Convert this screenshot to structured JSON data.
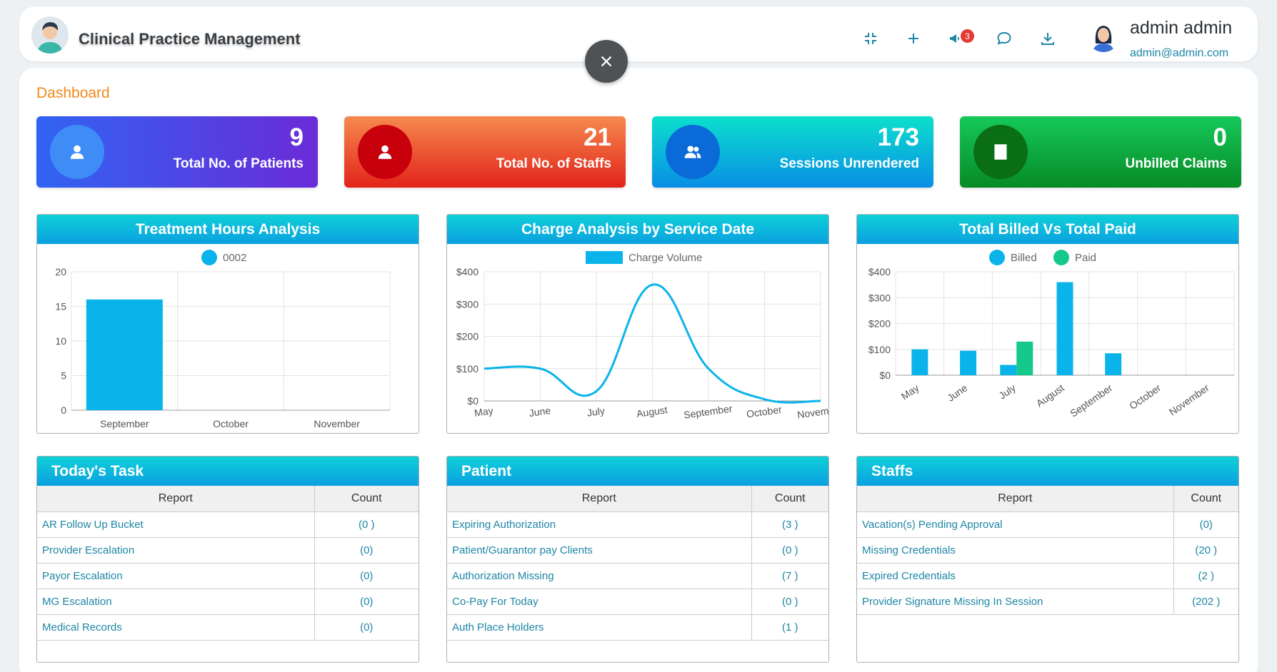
{
  "header": {
    "app_title": "Clinical Practice Management",
    "notification_count": "3",
    "user_name": "admin admin",
    "user_email": "admin@admin.com",
    "icons": [
      "compress-icon",
      "plus-icon",
      "megaphone-icon",
      "chat-icon",
      "download-icon"
    ]
  },
  "page": {
    "title": "Dashboard"
  },
  "stats": [
    {
      "value": "9",
      "label": "Total No. of Patients",
      "color": "#3d5af1",
      "icon": "user-icon"
    },
    {
      "value": "21",
      "label": "Total No. of Staffs",
      "color": "#e53935",
      "icon": "user-icon"
    },
    {
      "value": "173",
      "label": "Sessions Unrendered",
      "color": "#0ab3d9",
      "icon": "users-icon"
    },
    {
      "value": "0",
      "label": "Unbilled Claims",
      "color": "#1faa34",
      "icon": "building-icon"
    }
  ],
  "charts": {
    "treatment": {
      "title": "Treatment Hours Analysis"
    },
    "charge": {
      "title": "Charge Analysis by Service Date"
    },
    "billed": {
      "title": "Total Billed Vs Total Paid"
    }
  },
  "chart_data": [
    {
      "type": "bar",
      "title": "Treatment Hours Analysis",
      "categories": [
        "September",
        "October",
        "November"
      ],
      "series": [
        {
          "name": "0002",
          "values": [
            16,
            0,
            0
          ]
        }
      ],
      "ylim": [
        0,
        20
      ],
      "yticks": [
        0,
        5,
        10,
        15,
        20
      ],
      "grid": true,
      "legend": "top",
      "colors": [
        "#0ab4ea"
      ]
    },
    {
      "type": "line",
      "title": "Charge Analysis by Service Date",
      "categories": [
        "May",
        "June",
        "July",
        "August",
        "September",
        "October",
        "November"
      ],
      "series": [
        {
          "name": "Charge Volume",
          "values": [
            100,
            100,
            30,
            360,
            100,
            5,
            0
          ]
        }
      ],
      "ylim": [
        0,
        400
      ],
      "yticks": [
        "$0",
        "$100",
        "$200",
        "$300",
        "$400"
      ],
      "grid": true,
      "legend": "top",
      "colors": [
        "#0ab4ea"
      ]
    },
    {
      "type": "bar",
      "title": "Total Billed Vs Total Paid",
      "categories": [
        "May",
        "June",
        "July",
        "August",
        "September",
        "October",
        "November"
      ],
      "series": [
        {
          "name": "Billed",
          "values": [
            100,
            95,
            40,
            360,
            85,
            0,
            0
          ]
        },
        {
          "name": "Paid",
          "values": [
            0,
            0,
            130,
            0,
            0,
            0,
            0
          ]
        }
      ],
      "ylim": [
        0,
        400
      ],
      "yticks": [
        "$0",
        "$100",
        "$200",
        "$300",
        "$400"
      ],
      "grid": true,
      "legend": "top",
      "colors": [
        "#0ab4ea",
        "#14c98a"
      ]
    }
  ],
  "tables": [
    {
      "title": "Today's Task",
      "col_report": "Report",
      "col_count": "Count",
      "rows": [
        {
          "report": "AR Follow Up Bucket",
          "count": "(0 )"
        },
        {
          "report": "Provider Escalation",
          "count": "(0)"
        },
        {
          "report": "Payor Escalation",
          "count": "(0)"
        },
        {
          "report": "MG Escalation",
          "count": "(0)"
        },
        {
          "report": "Medical Records",
          "count": "(0)"
        }
      ]
    },
    {
      "title": "Patient",
      "col_report": "Report",
      "col_count": "Count",
      "rows": [
        {
          "report": "Expiring Authorization",
          "count": "(3 )"
        },
        {
          "report": "Patient/Guarantor pay Clients",
          "count": "(0 )"
        },
        {
          "report": "Authorization Missing",
          "count": "(7 )"
        },
        {
          "report": "Co-Pay For Today",
          "count": "(0 )"
        },
        {
          "report": "Auth Place Holders",
          "count": "(1 )"
        }
      ]
    },
    {
      "title": "Staffs",
      "col_report": "Report",
      "col_count": "Count",
      "rows": [
        {
          "report": "Vacation(s) Pending Approval",
          "count": "(0)"
        },
        {
          "report": "Missing Credentials",
          "count": "(20 )"
        },
        {
          "report": "Expired Credentials",
          "count": "(2 )"
        },
        {
          "report": "Provider Signature Missing In Session",
          "count": "(202 )"
        }
      ]
    }
  ]
}
